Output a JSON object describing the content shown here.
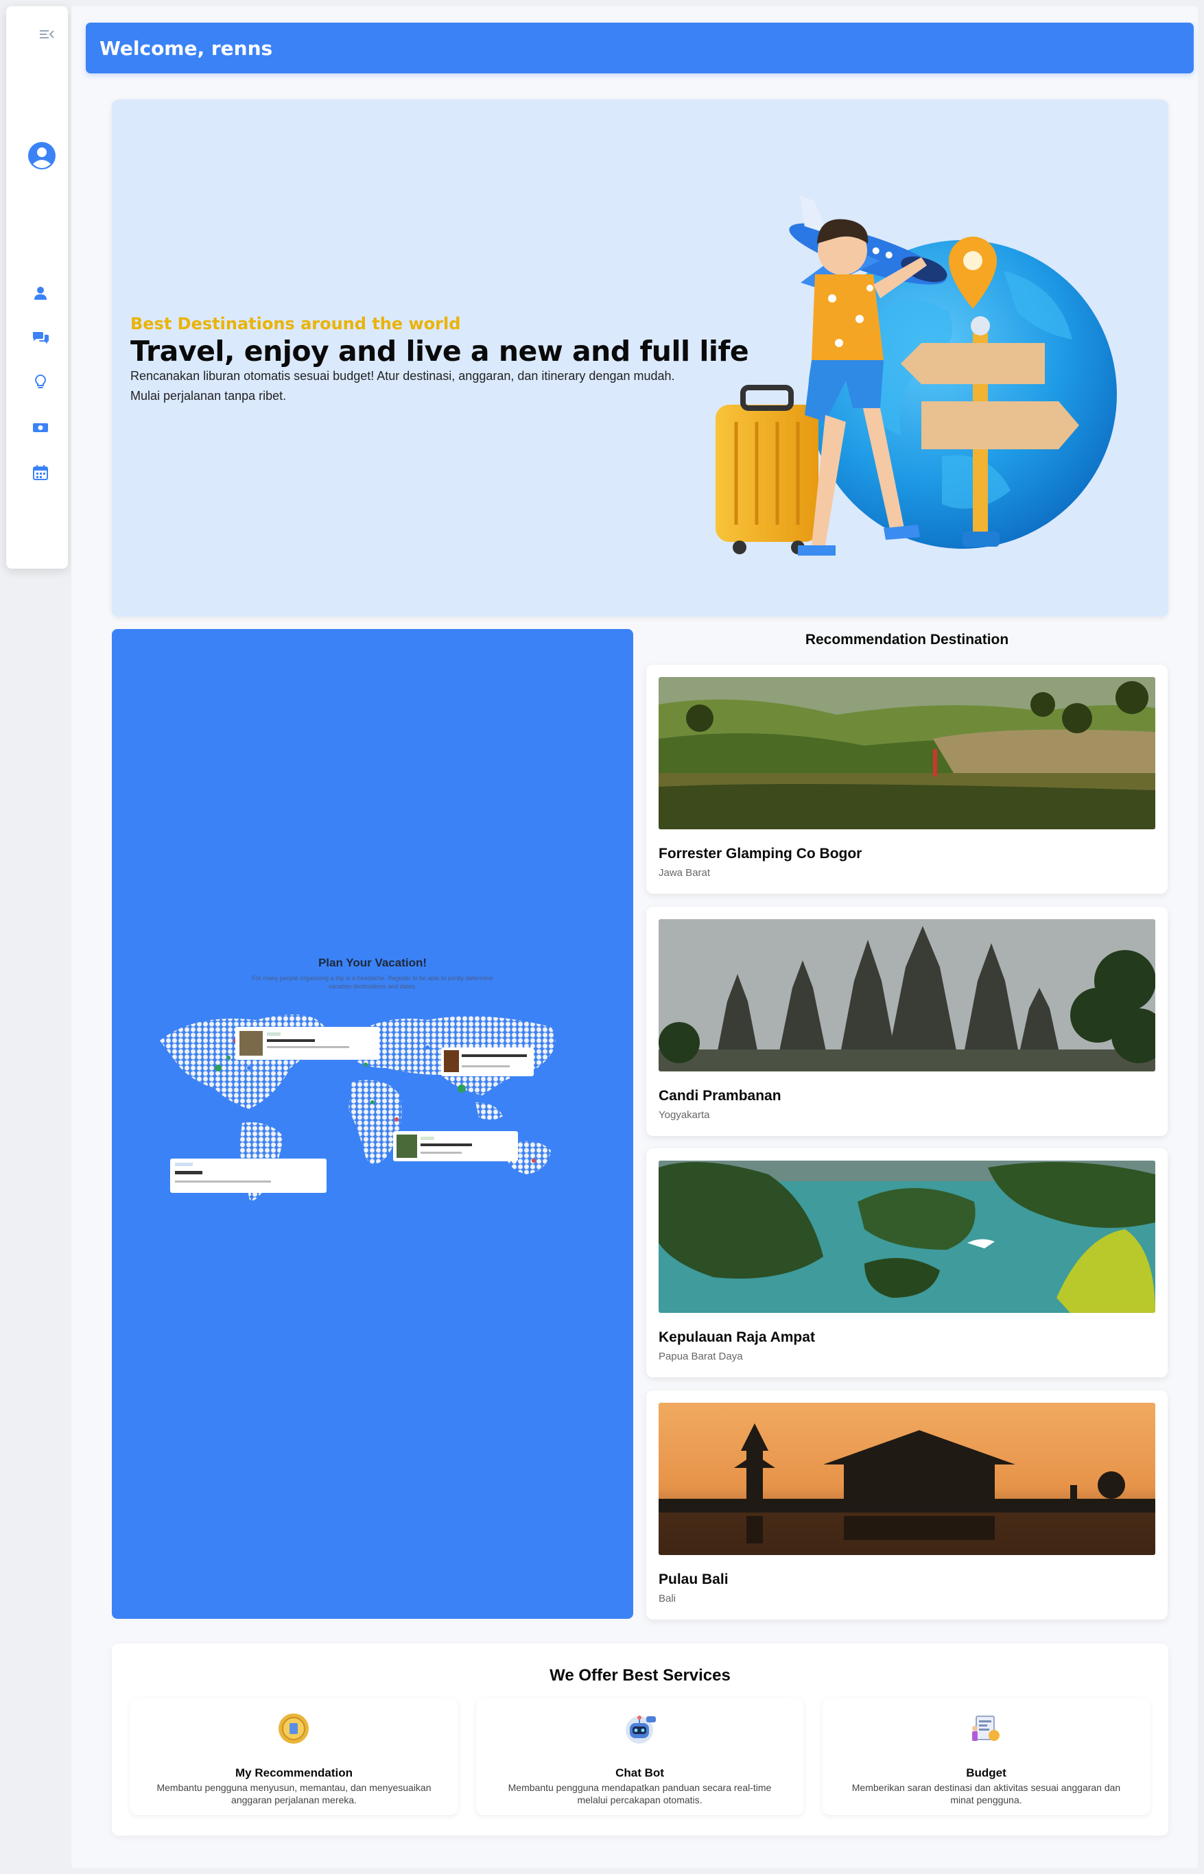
{
  "colors": {
    "primary": "#3b82f6",
    "accent_yellow": "#eab308",
    "hero_bg": "#dbe9fd",
    "page_bg": "#f7f8fb"
  },
  "sidebar": {
    "toggle_icon": "menu-collapse-icon",
    "avatar_icon": "user-circle-icon",
    "items": [
      {
        "icon": "user-icon",
        "name": "profile"
      },
      {
        "icon": "chat-icon",
        "name": "chat"
      },
      {
        "icon": "lightbulb-icon",
        "name": "recommendation"
      },
      {
        "icon": "money-icon",
        "name": "budget"
      },
      {
        "icon": "calendar-icon",
        "name": "itinerary"
      }
    ]
  },
  "header": {
    "welcome": "Welcome, renns"
  },
  "hero": {
    "eyebrow": "Best Destinations around the world",
    "title": "Travel, enjoy and live a new and full life",
    "description": "Rencanakan liburan otomatis sesuai budget! Atur destinasi, anggaran, dan itinerary dengan mudah. Mulai perjalanan tanpa ribet."
  },
  "plan": {
    "title": "Plan Your Vacation!",
    "subtitle": "For many people organizing a trip is a headache. Register to be able to jointly determine vacation destinations and dates."
  },
  "recommendations": {
    "title": "Recommendation Destination",
    "items": [
      {
        "name": "Forrester Glamping Co Bogor",
        "region": "Jawa Barat"
      },
      {
        "name": "Candi Prambanan",
        "region": "Yogyakarta"
      },
      {
        "name": "Kepulauan Raja Ampat",
        "region": "Papua Barat Daya"
      },
      {
        "name": "Pulau Bali",
        "region": "Bali"
      }
    ]
  },
  "services": {
    "title": "We Offer Best Services",
    "items": [
      {
        "name": "My Recommendation",
        "description": "Membantu pengguna menyusun, memantau, dan menyesuaikan anggaran perjalanan mereka.",
        "icon": "coin-icon"
      },
      {
        "name": "Chat Bot",
        "description": "Membantu pengguna mendapatkan panduan secara real-time melalui percakapan otomatis.",
        "icon": "robot-icon"
      },
      {
        "name": "Budget",
        "description": "Memberikan saran destinasi dan aktivitas sesuai anggaran dan minat pengguna.",
        "icon": "budget-icon"
      }
    ]
  }
}
